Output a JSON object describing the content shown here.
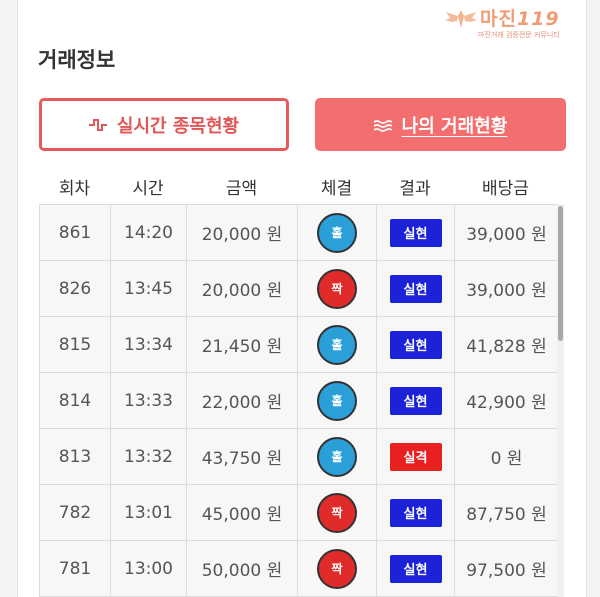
{
  "watermark": {
    "brand": "마진",
    "badge": "119",
    "tagline": "마진거래 검증전문 커뮤니티"
  },
  "section_title": "거래정보",
  "buttons": {
    "realtime": {
      "label": "실시간 종목현황",
      "icon": "pulse-icon"
    },
    "my_trades": {
      "label": "나의 거래현황",
      "icon": "wave-lines-icon"
    }
  },
  "columns": [
    "회차",
    "시간",
    "금액",
    "체결",
    "결과",
    "배당금"
  ],
  "rows": [
    {
      "round": "861",
      "time": "14:20",
      "amount": "20,000 원",
      "side": "홀",
      "result": "실현",
      "payout": "39,000 원"
    },
    {
      "round": "826",
      "time": "13:45",
      "amount": "20,000 원",
      "side": "짝",
      "result": "실현",
      "payout": "39,000 원"
    },
    {
      "round": "815",
      "time": "13:34",
      "amount": "21,450 원",
      "side": "홀",
      "result": "실현",
      "payout": "41,828 원"
    },
    {
      "round": "814",
      "time": "13:33",
      "amount": "22,000 원",
      "side": "홀",
      "result": "실현",
      "payout": "42,900 원"
    },
    {
      "round": "813",
      "time": "13:32",
      "amount": "43,750 원",
      "side": "홀",
      "result": "실격",
      "payout": "0 원"
    },
    {
      "round": "782",
      "time": "13:01",
      "amount": "45,000 원",
      "side": "짝",
      "result": "실현",
      "payout": "87,750 원"
    },
    {
      "round": "781",
      "time": "13:00",
      "amount": "50,000 원",
      "side": "짝",
      "result": "실현",
      "payout": "97,500 원"
    }
  ],
  "colors": {
    "odd_ball": "#2a9fd8",
    "even_ball": "#e02b2b",
    "result_win": "#1b22d8",
    "result_lose": "#e82020",
    "accent": "#f36f6f"
  }
}
